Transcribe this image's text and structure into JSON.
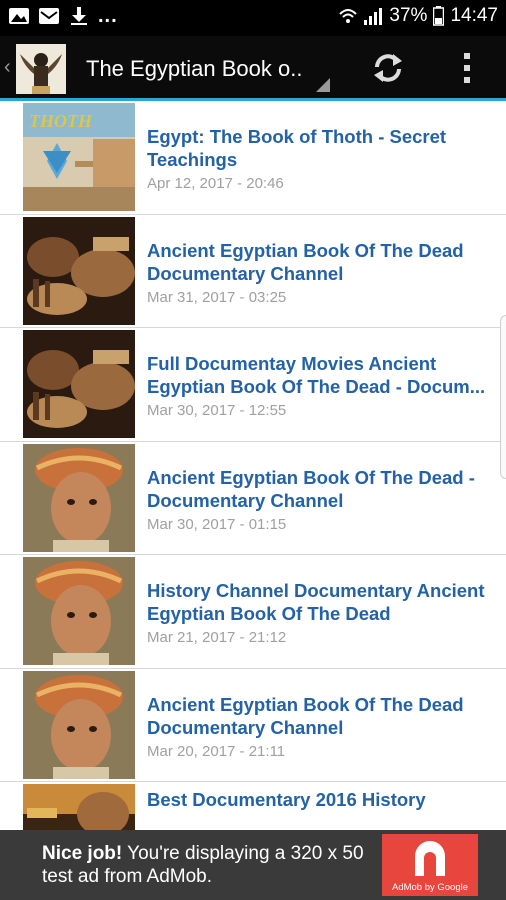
{
  "status_bar": {
    "dots": "...",
    "battery": "37%",
    "time": "14:47"
  },
  "action_bar": {
    "title": "The Egyptian Book o..",
    "accent_color": "#29a5dc"
  },
  "videos": [
    {
      "title": "Egypt: The Book of Thoth - Secret Teachings",
      "date": "Apr 12, 2017 - 20:46"
    },
    {
      "title": "Ancient Egyptian Book Of The Dead Documentary Channel",
      "date": "Mar 31, 2017 - 03:25"
    },
    {
      "title": "Full Documentay Movies Ancient Egyptian Book Of The Dead - Docum...",
      "date": "Mar 30, 2017 - 12:55"
    },
    {
      "title": "Ancient Egyptian Book Of The Dead - Documentary Channel",
      "date": "Mar 30, 2017 - 01:15"
    },
    {
      "title": "History Channel Documentary Ancient Egyptian Book Of The Dead",
      "date": "Mar 21, 2017 - 21:12"
    },
    {
      "title": "Ancient Egyptian Book Of The Dead Documentary Channel",
      "date": "Mar 20, 2017 - 21:11"
    },
    {
      "title": "Best Documentary 2016 History",
      "date": ""
    }
  ],
  "ad": {
    "headline": "Nice job!",
    "body": " You're displaying a 320 x 50 test ad from AdMob.",
    "logo_caption": "AdMob by Google",
    "logo_color": "#e8453c"
  }
}
